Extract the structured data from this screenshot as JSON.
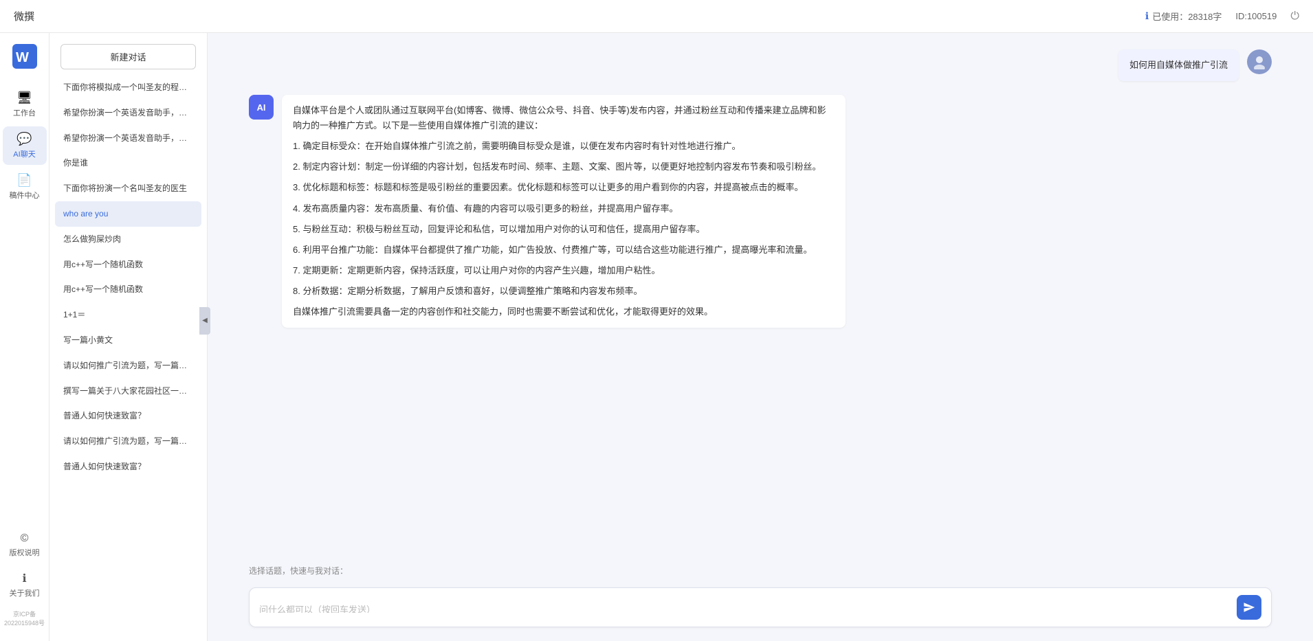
{
  "topbar": {
    "title": "微撰",
    "usage_label": "已使用：28318字",
    "id_label": "ID:100519",
    "usage_icon": "info-icon",
    "logout_icon": "logout-icon"
  },
  "left_nav": {
    "logo_text": "W 微撰",
    "items": [
      {
        "id": "workbench",
        "label": "工作台",
        "icon": "🖥"
      },
      {
        "id": "ai-chat",
        "label": "AI聊天",
        "icon": "💬",
        "active": true
      },
      {
        "id": "drafts",
        "label": "稿件中心",
        "icon": "📄"
      }
    ],
    "bottom_items": [
      {
        "id": "copyright",
        "label": "版权说明",
        "icon": "©"
      },
      {
        "id": "about",
        "label": "关于我们",
        "icon": "ℹ"
      }
    ],
    "icp": "京ICP备2022015948号"
  },
  "history_sidebar": {
    "new_btn": "新建对话",
    "items": [
      {
        "id": 1,
        "text": "下面你将模拟成一个叫圣友的程序员，我说...",
        "active": false
      },
      {
        "id": 2,
        "text": "希望你扮演一个英语发音助手，我提供给你...",
        "active": false
      },
      {
        "id": 3,
        "text": "希望你扮演一个英语发音助手，我提供给你...",
        "active": false
      },
      {
        "id": 4,
        "text": "你是谁",
        "active": false
      },
      {
        "id": 5,
        "text": "下面你将扮演一个名叫圣友的医生",
        "active": false
      },
      {
        "id": 6,
        "text": "who are you",
        "active": true
      },
      {
        "id": 7,
        "text": "怎么做狗屎炒肉",
        "active": false
      },
      {
        "id": 8,
        "text": "用c++写一个随机函数",
        "active": false
      },
      {
        "id": 9,
        "text": "用c++写一个随机函数",
        "active": false
      },
      {
        "id": 10,
        "text": "1+1＝",
        "active": false
      },
      {
        "id": 11,
        "text": "写一篇小黄文",
        "active": false
      },
      {
        "id": 12,
        "text": "请以如何推广引流为题，写一篇大纲",
        "active": false
      },
      {
        "id": 13,
        "text": "撰写一篇关于八大家花园社区一刻钟便民生...",
        "active": false
      },
      {
        "id": 14,
        "text": "普通人如何快速致富？",
        "active": false
      },
      {
        "id": 15,
        "text": "请以如何推广引流为题，写一篇大纲",
        "active": false
      },
      {
        "id": 16,
        "text": "普通人如何快速致富？",
        "active": false
      }
    ]
  },
  "chat": {
    "user_message": "如何用自媒体做推广引流",
    "ai_response_paragraphs": [
      "自媒体平台是个人或团队通过互联网平台(如博客、微博、微信公众号、抖音、快手等)发布内容，并通过粉丝互动和传播来建立品牌和影响力的一种推广方式。以下是一些使用自媒体推广引流的建议：",
      "1. 确定目标受众：在开始自媒体推广引流之前，需要明确目标受众是谁，以便在发布内容时有针对性地进行推广。",
      "2. 制定内容计划：制定一份详细的内容计划，包括发布时间、频率、主题、文案、图片等，以便更好地控制内容发布节奏和吸引粉丝。",
      "3. 优化标题和标签：标题和标签是吸引粉丝的重要因素。优化标题和标签可以让更多的用户看到你的内容，并提高被点击的概率。",
      "4. 发布高质量内容：发布高质量、有价值、有趣的内容可以吸引更多的粉丝，并提高用户留存率。",
      "5. 与粉丝互动：积极与粉丝互动，回复评论和私信，可以增加用户对你的认可和信任，提高用户留存率。",
      "6. 利用平台推广功能：自媒体平台都提供了推广功能，如广告投放、付费推广等，可以结合这些功能进行推广，提高曝光率和流量。",
      "7. 定期更新：定期更新内容，保持活跃度，可以让用户对你的内容产生兴趣，增加用户粘性。",
      "8. 分析数据：定期分析数据，了解用户反馈和喜好，以便调整推广策略和内容发布频率。",
      "自媒体推广引流需要具备一定的内容创作和社交能力，同时也需要不断尝试和优化，才能取得更好的效果。"
    ],
    "quick_topics_label": "选择话题，快速与我对话：",
    "input_placeholder": "问什么都可以（按回车发送）"
  }
}
